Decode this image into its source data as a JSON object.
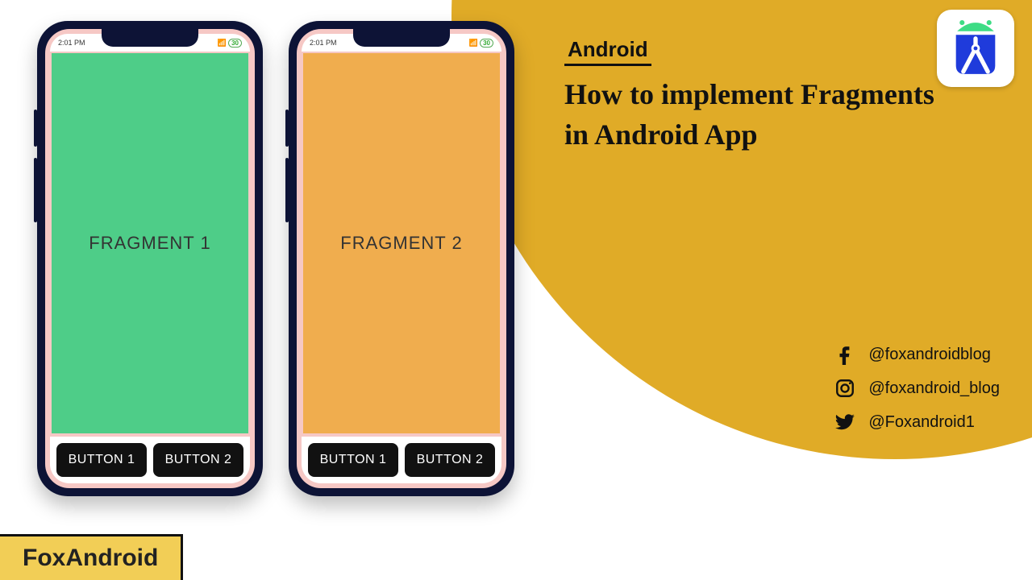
{
  "title": {
    "label": "Android",
    "line1": "How to implement Fragments",
    "line2": "in Android App"
  },
  "brand": "FoxAndroid",
  "socials": {
    "facebook": "@foxandroidblog",
    "instagram": "@foxandroid_blog",
    "twitter": "@Foxandroid1"
  },
  "phones": [
    {
      "status_time": "2:01 PM",
      "status_battery": "30",
      "fragment_label": "FRAGMENT 1",
      "fragment_color": "green",
      "button1": "BUTTON 1",
      "button2": "BUTTON 2"
    },
    {
      "status_time": "2:01 PM",
      "status_battery": "30",
      "fragment_label": "FRAGMENT 2",
      "fragment_color": "orange",
      "button1": "BUTTON 1",
      "button2": "BUTTON 2"
    }
  ],
  "colors": {
    "circle": "#e0ab27",
    "brand_bg": "#f2ce56",
    "frag_green": "#4ecd88",
    "frag_orange": "#f0ad4e"
  }
}
